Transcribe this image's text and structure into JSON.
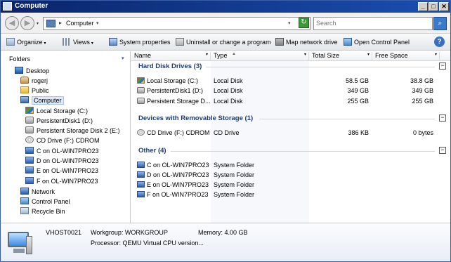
{
  "window": {
    "title": "Computer",
    "minimize_glyph": "_",
    "maximize_glyph": "□",
    "close_glyph": "✕"
  },
  "address": {
    "back_glyph": "◀",
    "forward_glyph": "▶",
    "history_glyph": "▾",
    "separator_glyph": "▸",
    "path": "Computer",
    "path_dropdown_glyph": "▾",
    "address_dropdown_glyph": "▾",
    "refresh_glyph": "↻",
    "search_placeholder": "Search",
    "search_glyph": "⌕"
  },
  "commands": {
    "organize": "Organize",
    "views": "Views",
    "system_properties": "System properties",
    "uninstall": "Uninstall or change a program",
    "map_network": "Map network drive",
    "control_panel": "Open Control Panel",
    "dropdown_glyph": "▾",
    "help_glyph": "?"
  },
  "nav": {
    "header": "Folders",
    "collapse_glyph": "▾",
    "items": [
      {
        "label": "Desktop",
        "icon": "desktop-icon"
      },
      {
        "label": "rogerj",
        "icon": "user-folder-icon"
      },
      {
        "label": "Public",
        "icon": "folder-icon"
      },
      {
        "label": "Computer",
        "icon": "computer-icon"
      },
      {
        "label": "Local Storage (C:)",
        "icon": "windows-drive-icon"
      },
      {
        "label": "PersistentDisk1 (D:)",
        "icon": "drive-icon"
      },
      {
        "label": "Persistent Storage Disk 2 (E:)",
        "icon": "drive-icon"
      },
      {
        "label": "CD Drive (F:) CDROM",
        "icon": "cd-drive-icon"
      },
      {
        "label": "C on OL-WIN7PRO23",
        "icon": "network-drive-icon"
      },
      {
        "label": "D on OL-WIN7PRO23",
        "icon": "network-drive-icon"
      },
      {
        "label": "E on OL-WIN7PRO23",
        "icon": "network-drive-icon"
      },
      {
        "label": "F on OL-WIN7PRO23",
        "icon": "network-drive-icon"
      },
      {
        "label": "Network",
        "icon": "network-icon"
      },
      {
        "label": "Control Panel",
        "icon": "control-panel-icon"
      },
      {
        "label": "Recycle Bin",
        "icon": "recycle-bin-icon"
      }
    ]
  },
  "columns": {
    "name": "Name",
    "type": "Type",
    "total": "Total Size",
    "free": "Free Space",
    "sort_glyph": "▲",
    "dropdown_glyph": "▾"
  },
  "groups": [
    {
      "title": "Hard Disk Drives (3)",
      "collapse_glyph": "−",
      "rows": [
        {
          "name": "Local Storage (C:)",
          "type": "Local Disk",
          "total": "58.5 GB",
          "free": "38.8 GB",
          "icon": "windows-drive-icon"
        },
        {
          "name": "PersistentDisk1 (D:)",
          "type": "Local Disk",
          "total": "349 GB",
          "free": "349 GB",
          "icon": "drive-icon"
        },
        {
          "name": "Persistent Storage D...",
          "type": "Local Disk",
          "total": "255 GB",
          "free": "255 GB",
          "icon": "drive-icon"
        }
      ]
    },
    {
      "title": "Devices with Removable Storage (1)",
      "collapse_glyph": "−",
      "rows": [
        {
          "name": "CD Drive (F:) CDROM",
          "type": "CD Drive",
          "total": "386 KB",
          "free": "0 bytes",
          "icon": "cd-drive-icon"
        }
      ]
    },
    {
      "title": "Other (4)",
      "collapse_glyph": "−",
      "rows": [
        {
          "name": "C on OL-WIN7PRO23",
          "type": "System Folder",
          "total": "",
          "free": "",
          "icon": "network-drive-icon"
        },
        {
          "name": "D on OL-WIN7PRO23",
          "type": "System Folder",
          "total": "",
          "free": "",
          "icon": "network-drive-icon"
        },
        {
          "name": "E on OL-WIN7PRO23",
          "type": "System Folder",
          "total": "",
          "free": "",
          "icon": "network-drive-icon"
        },
        {
          "name": "F on OL-WIN7PRO23",
          "type": "System Folder",
          "total": "",
          "free": "",
          "icon": "network-drive-icon"
        }
      ]
    }
  ],
  "details": {
    "computer_name": "VHOST0021",
    "workgroup": "Workgroup: WORKGROUP",
    "memory": "Memory: 4.00 GB",
    "processor": "Processor: QEMU Virtual CPU version..."
  },
  "colors": {
    "title_bar": "#0a246a",
    "group_title": "#1e3a6e",
    "selection": "#dde8f8"
  }
}
